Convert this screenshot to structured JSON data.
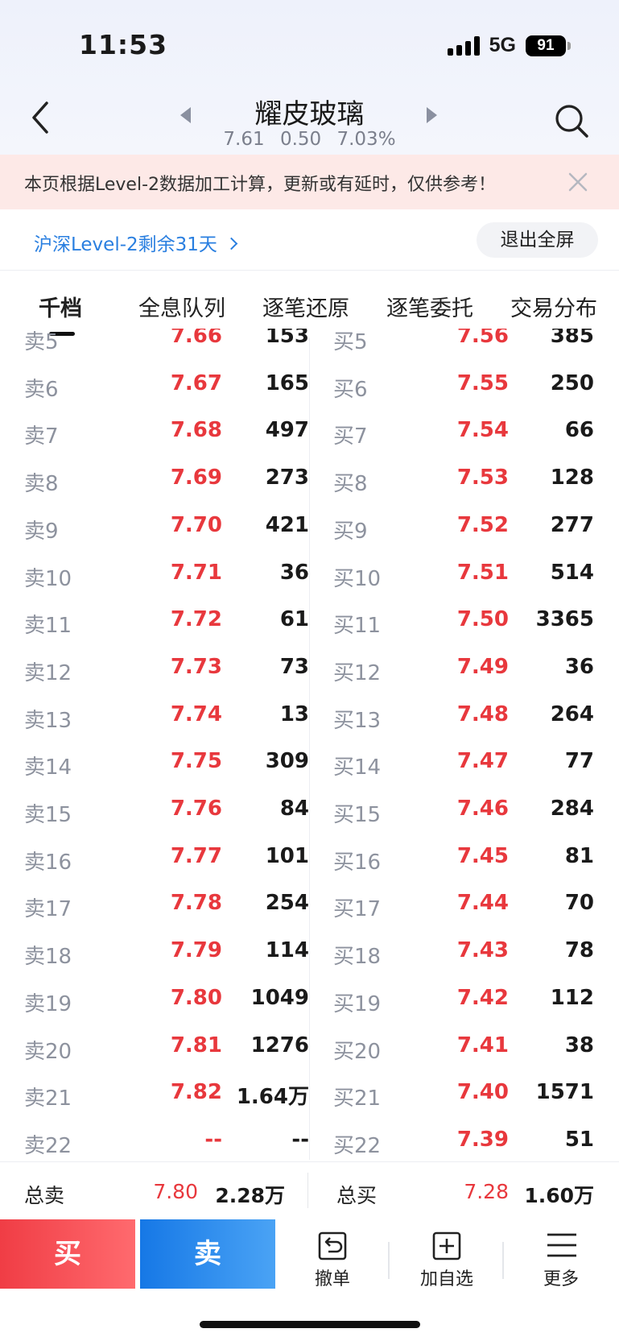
{
  "status_bar": {
    "time": "11:53",
    "network": "5G",
    "battery": "91"
  },
  "nav": {
    "title": "耀皮玻璃",
    "price": "7.61",
    "change": "0.50",
    "change_pct": "7.03%"
  },
  "notice": {
    "text": "本页根据Level-2数据加工计算，更新或有延时，仅供参考！"
  },
  "level2": {
    "link_text": "沪深Level-2剩余31天",
    "exit_label": "退出全屏"
  },
  "tabs": [
    {
      "label": "千档",
      "active": true
    },
    {
      "label": "全息队列",
      "active": false
    },
    {
      "label": "逐笔还原",
      "active": false
    },
    {
      "label": "逐笔委托",
      "active": false
    },
    {
      "label": "交易分布",
      "active": false
    }
  ],
  "asks": [
    {
      "label": "卖5",
      "price": "7.66",
      "volume": "153"
    },
    {
      "label": "卖6",
      "price": "7.67",
      "volume": "165"
    },
    {
      "label": "卖7",
      "price": "7.68",
      "volume": "497"
    },
    {
      "label": "卖8",
      "price": "7.69",
      "volume": "273"
    },
    {
      "label": "卖9",
      "price": "7.70",
      "volume": "421"
    },
    {
      "label": "卖10",
      "price": "7.71",
      "volume": "36"
    },
    {
      "label": "卖11",
      "price": "7.72",
      "volume": "61"
    },
    {
      "label": "卖12",
      "price": "7.73",
      "volume": "73"
    },
    {
      "label": "卖13",
      "price": "7.74",
      "volume": "13"
    },
    {
      "label": "卖14",
      "price": "7.75",
      "volume": "309"
    },
    {
      "label": "卖15",
      "price": "7.76",
      "volume": "84"
    },
    {
      "label": "卖16",
      "price": "7.77",
      "volume": "101"
    },
    {
      "label": "卖17",
      "price": "7.78",
      "volume": "254"
    },
    {
      "label": "卖18",
      "price": "7.79",
      "volume": "114"
    },
    {
      "label": "卖19",
      "price": "7.80",
      "volume": "1049"
    },
    {
      "label": "卖20",
      "price": "7.81",
      "volume": "1276"
    },
    {
      "label": "卖21",
      "price": "7.82",
      "volume": "1.64万"
    },
    {
      "label": "卖22",
      "price": "--",
      "volume": "--"
    }
  ],
  "bids": [
    {
      "label": "买5",
      "price": "7.56",
      "volume": "385"
    },
    {
      "label": "买6",
      "price": "7.55",
      "volume": "250"
    },
    {
      "label": "买7",
      "price": "7.54",
      "volume": "66"
    },
    {
      "label": "买8",
      "price": "7.53",
      "volume": "128"
    },
    {
      "label": "买9",
      "price": "7.52",
      "volume": "277"
    },
    {
      "label": "买10",
      "price": "7.51",
      "volume": "514"
    },
    {
      "label": "买11",
      "price": "7.50",
      "volume": "3365"
    },
    {
      "label": "买12",
      "price": "7.49",
      "volume": "36"
    },
    {
      "label": "买13",
      "price": "7.48",
      "volume": "264"
    },
    {
      "label": "买14",
      "price": "7.47",
      "volume": "77"
    },
    {
      "label": "买15",
      "price": "7.46",
      "volume": "284"
    },
    {
      "label": "买16",
      "price": "7.45",
      "volume": "81"
    },
    {
      "label": "买17",
      "price": "7.44",
      "volume": "70"
    },
    {
      "label": "买18",
      "price": "7.43",
      "volume": "78"
    },
    {
      "label": "买19",
      "price": "7.42",
      "volume": "112"
    },
    {
      "label": "买20",
      "price": "7.41",
      "volume": "38"
    },
    {
      "label": "买21",
      "price": "7.40",
      "volume": "1571"
    },
    {
      "label": "买22",
      "price": "7.39",
      "volume": "51"
    }
  ],
  "totals": {
    "sell_label": "总卖",
    "sell_price": "7.80",
    "sell_volume": "2.28万",
    "buy_label": "总买",
    "buy_price": "7.28",
    "buy_volume": "1.60万"
  },
  "bottom_bar": {
    "buy_label": "买",
    "sell_label": "卖",
    "cancel_label": "撤单",
    "watchlist_label": "加自选",
    "more_label": "更多"
  },
  "colors": {
    "up_red": "#e8383d",
    "buy_red": "#f03d45",
    "sell_blue": "#1678e6",
    "link_blue": "#2a7fe0",
    "notice_bg": "#fde9e7"
  }
}
